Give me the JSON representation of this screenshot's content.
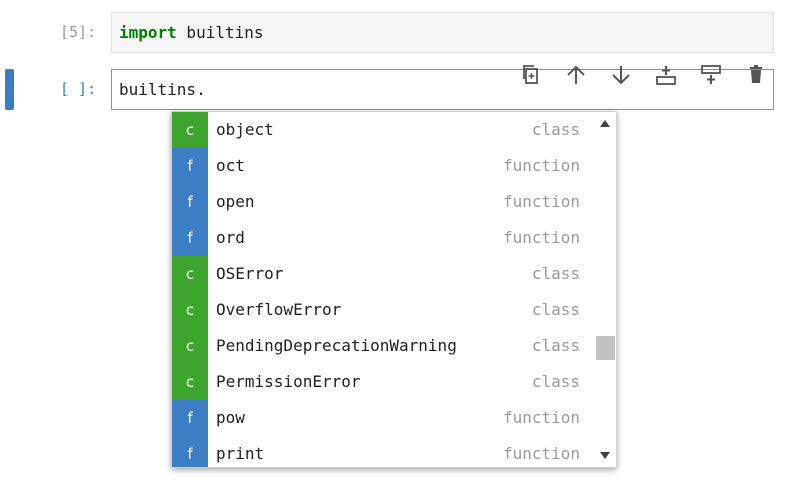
{
  "cells": [
    {
      "prompt": "[5]:",
      "keyword": "import",
      "code_rest": " builtins"
    },
    {
      "prompt": "[ ]:",
      "code": "builtins."
    }
  ],
  "toolbar": {
    "buttons": [
      "duplicate-icon",
      "move-up-icon",
      "move-down-icon",
      "insert-above-icon",
      "insert-below-icon",
      "delete-icon"
    ]
  },
  "completer": {
    "items": [
      {
        "icon": "c",
        "name": "object",
        "type": "class"
      },
      {
        "icon": "f",
        "name": "oct",
        "type": "function"
      },
      {
        "icon": "f",
        "name": "open",
        "type": "function"
      },
      {
        "icon": "f",
        "name": "ord",
        "type": "function"
      },
      {
        "icon": "c",
        "name": "OSError",
        "type": "class"
      },
      {
        "icon": "c",
        "name": "OverflowError",
        "type": "class"
      },
      {
        "icon": "c",
        "name": "PendingDeprecationWarning",
        "type": "class"
      },
      {
        "icon": "c",
        "name": "PermissionError",
        "type": "class"
      },
      {
        "icon": "f",
        "name": "pow",
        "type": "function"
      },
      {
        "icon": "f",
        "name": "print",
        "type": "function"
      }
    ],
    "scroll_position": 0.7
  },
  "colors": {
    "class_icon": "#3da52e",
    "function_icon": "#3b7ec4",
    "active_cell": "#3b7ec4"
  }
}
